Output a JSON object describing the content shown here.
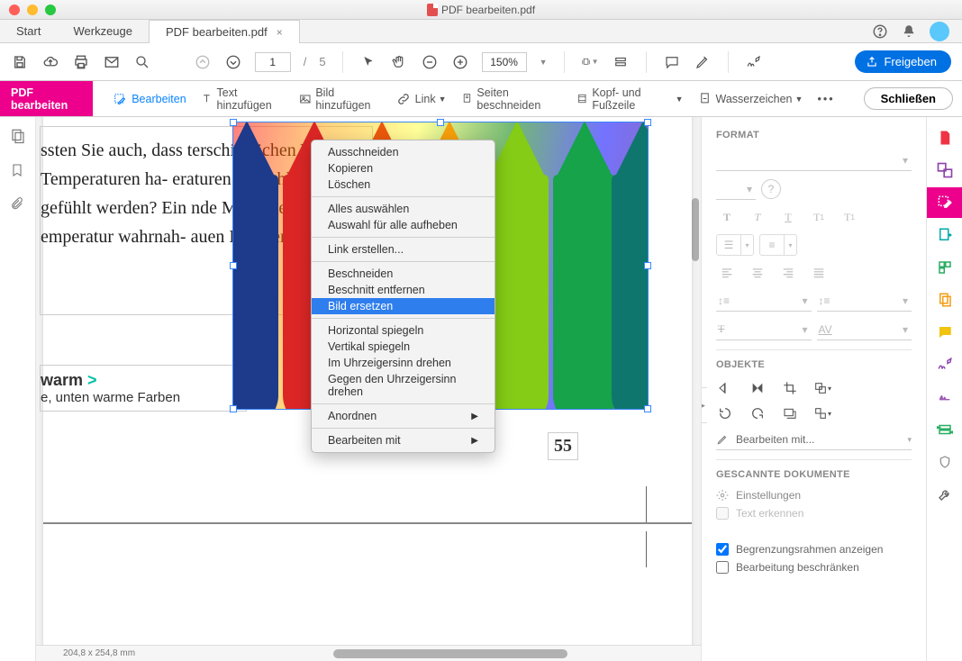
{
  "window": {
    "title": "PDF bearbeiten.pdf"
  },
  "tabs": {
    "start": "Start",
    "tools": "Werkzeuge",
    "doc": "PDF bearbeiten.pdf"
  },
  "toolbar": {
    "page_current": "1",
    "page_sep": "/",
    "page_total": "5",
    "zoom": "150%",
    "share": "Freigeben"
  },
  "subbar": {
    "section": "PDF bearbeiten",
    "edit": "Bearbeiten",
    "add_text": "Text hinzufügen",
    "add_image": "Bild hinzufügen",
    "link": "Link",
    "crop_pages": "Seiten beschneiden",
    "header_footer": "Kopf- und Fußzeile",
    "watermark": "Wasserzeichen",
    "close": "Schließen"
  },
  "document": {
    "para1": "ssten Sie auch, dass terschiedlichen Wel- e Temperaturen ha- eraturen tatsächlich gefühlt werden? Ein nde Menschen in ro- emperatur wahrnah- auen Räumen. Faszi-",
    "heading2_a": "warm",
    "heading2_arrow": ">",
    "para2": "e, unten warme Farben",
    "page_num": "55"
  },
  "context_menu": {
    "items": [
      "Ausschneiden",
      "Kopieren",
      "Löschen",
      "-",
      "Alles auswählen",
      "Auswahl für alle aufheben",
      "-",
      "Link erstellen...",
      "-",
      "Beschneiden",
      "Beschnitt entfernen",
      "Bild ersetzen",
      "-",
      "Horizontal spiegeln",
      "Vertikal spiegeln",
      "Im Uhrzeigersinn drehen",
      "Gegen den Uhrzeigersinn drehen",
      "-",
      "Anordnen",
      "-",
      "Bearbeiten mit"
    ],
    "selected": "Bild ersetzen",
    "submenu": [
      "Anordnen",
      "Bearbeiten mit"
    ]
  },
  "right_panel": {
    "format": "FORMAT",
    "objects": "OBJEKTE",
    "edit_with": "Bearbeiten mit...",
    "scanned": "GESCANNTE DOKUMENTE",
    "settings": "Einstellungen",
    "ocr": "Text erkennen",
    "show_bounds": "Begrenzungsrahmen anzeigen",
    "restrict_edit": "Bearbeitung beschränken"
  },
  "statusbar": {
    "dims": "204,8 x 254,8 mm"
  }
}
